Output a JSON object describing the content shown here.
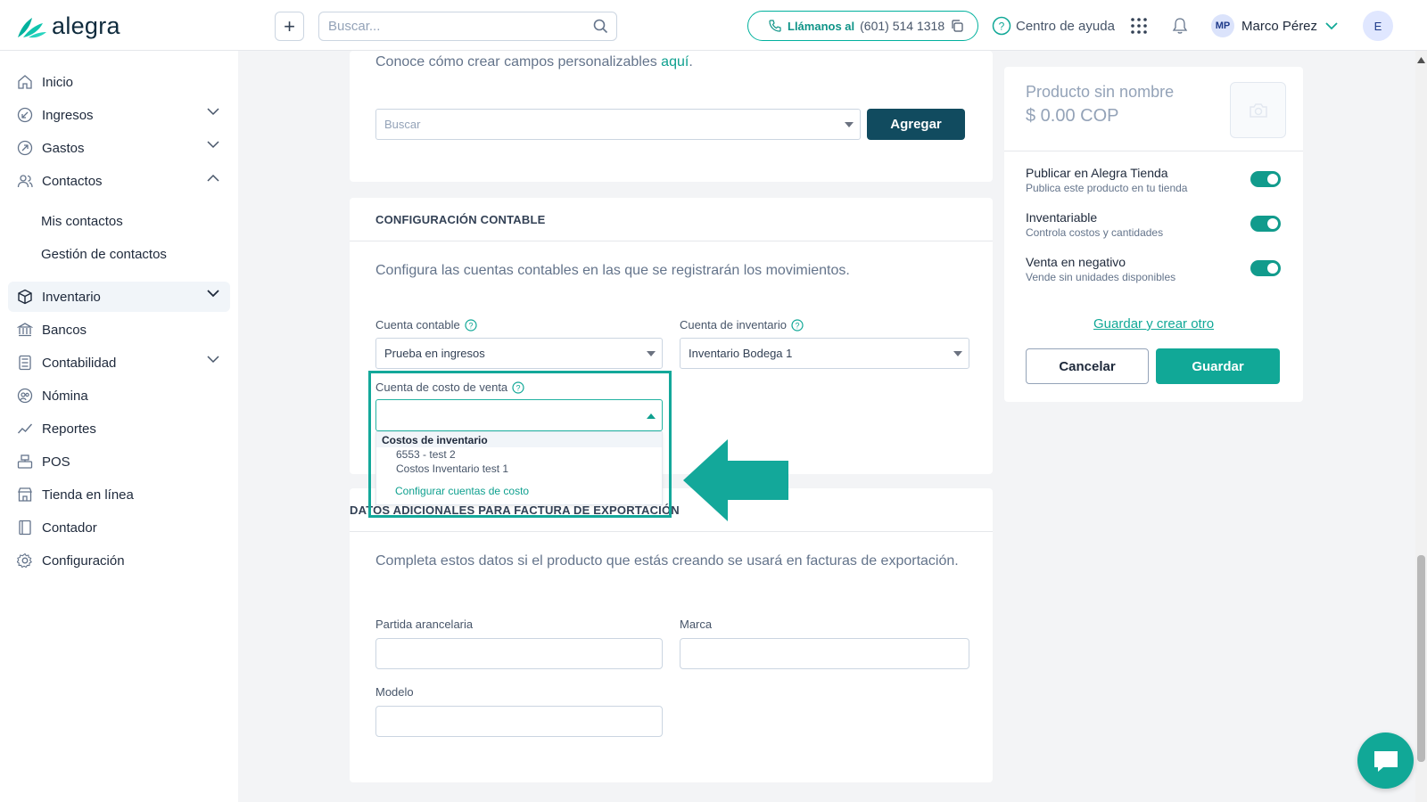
{
  "header": {
    "logo_text": "alegra",
    "search_placeholder": "Buscar...",
    "call_label": "Llámanos al",
    "call_number": "(601) 514 1318",
    "help_label": "Centro de ayuda",
    "user_initials": "MP",
    "user_name": "Marco Pérez",
    "account_initial": "E"
  },
  "sidebar": {
    "items": [
      {
        "label": "Inicio"
      },
      {
        "label": "Ingresos"
      },
      {
        "label": "Gastos"
      },
      {
        "label": "Contactos"
      },
      {
        "label": "Mis contactos"
      },
      {
        "label": "Gestión de contactos"
      },
      {
        "label": "Inventario"
      },
      {
        "label": "Bancos"
      },
      {
        "label": "Contabilidad"
      },
      {
        "label": "Nómina"
      },
      {
        "label": "Reportes"
      },
      {
        "label": "POS"
      },
      {
        "label": "Tienda en línea"
      },
      {
        "label": "Contador"
      },
      {
        "label": "Configuración"
      }
    ]
  },
  "custom_fields": {
    "help_text": "Conoce cómo crear campos personalizables",
    "help_link": "aquí",
    "help_suffix": ".",
    "search_placeholder": "Buscar",
    "add_button": "Agregar"
  },
  "accounting": {
    "title": "CONFIGURACIÓN CONTABLE",
    "description": "Configura las cuentas contables en las que se registrarán los movimientos.",
    "account_label": "Cuenta contable",
    "account_value": "Prueba en ingresos",
    "inventory_label": "Cuenta de inventario",
    "inventory_value": "Inventario Bodega 1",
    "cost_label": "Cuenta de costo de venta",
    "cost_value": "",
    "dropdown": {
      "group": "Costos de inventario",
      "options": [
        "6553 - test 2",
        "Costos Inventario test 1"
      ],
      "footer_link": "Configurar cuentas de costo"
    }
  },
  "export": {
    "title": "DATOS ADICIONALES PARA FACTURA DE EXPORTACIÓN",
    "description": "Completa estos datos si el producto que estás creando se usará en facturas de exportación.",
    "tariff_label": "Partida arancelaria",
    "brand_label": "Marca",
    "model_label": "Modelo"
  },
  "product_panel": {
    "name": "Producto sin nombre",
    "price": "$ 0.00 COP",
    "options": [
      {
        "title": "Publicar en Alegra Tienda",
        "subtitle": "Publica este producto en tu tienda",
        "enabled": true
      },
      {
        "title": "Inventariable",
        "subtitle": "Controla costos y cantidades",
        "enabled": true
      },
      {
        "title": "Venta en negativo",
        "subtitle": "Vende sin unidades disponibles",
        "enabled": true
      }
    ],
    "save_and_new": "Guardar y crear otro",
    "cancel": "Cancelar",
    "save": "Guardar"
  },
  "colors": {
    "brand": "#11a897",
    "dark_button": "#114b5f",
    "highlight": "#13a89a"
  }
}
